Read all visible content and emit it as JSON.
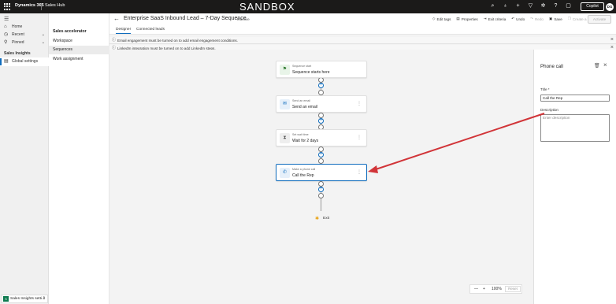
{
  "topbar": {
    "brand": "Dynamics 365",
    "app": "Sales Hub",
    "environment_label": "SANDBOX",
    "copilot": "Copilot",
    "avatar": "DG",
    "icons": [
      "search-icon",
      "lightbulb-icon",
      "plus-icon",
      "filter-icon",
      "settings-icon",
      "help-icon",
      "chat-icon"
    ]
  },
  "left_nav": {
    "home": "Home",
    "recent": "Recent",
    "pinned": "Pinned",
    "section": "Sales Insights",
    "global_settings": "Global settings",
    "area_switcher": "Sales Insights setti...",
    "area_badge": "S"
  },
  "sub_nav": {
    "heading": "Sales accelerator",
    "items": [
      "Workspace",
      "Sequences",
      "Work assignment"
    ]
  },
  "header": {
    "title": "Enterprise SaaS Inbound Lead – 7-Day Sequence",
    "state": "- Inactive",
    "commands": [
      "Edit tags",
      "Properties",
      "Exit criteria",
      "Undo",
      "Redo",
      "Save",
      "Create a copy"
    ],
    "activate": "Activate"
  },
  "tabs": [
    "Designer",
    "Connected leads"
  ],
  "banners": [
    "Email engagement must be turned on to add email engagement conditions.",
    "LinkedIn integration must be turned on to add LinkedIn steps."
  ],
  "steps": [
    {
      "label": "Sequence start",
      "name": "Sequence starts here",
      "icon": "flag-icon",
      "color": "#e8f4e8"
    },
    {
      "label": "Send an email",
      "name": "Send an email",
      "icon": "email-icon",
      "color": "#e6f0fa"
    },
    {
      "label": "Set wait time",
      "name": "Wait for 2 days",
      "icon": "wait-icon",
      "color": "#eeeeee"
    },
    {
      "label": "Make a phone call",
      "name": "Call the Rep",
      "icon": "phone-icon",
      "color": "#e6f0fa"
    }
  ],
  "exit_label": "Exit",
  "zoom": {
    "level": "100%",
    "reset": "Reset"
  },
  "panel": {
    "title": "Phone call",
    "title_label": "Title *",
    "title_value": "Call the Rep",
    "description_label": "Description",
    "description_placeholder": "Enter description"
  },
  "colors": {
    "accent": "#0f6cbd",
    "annotation_arrow": "#d13438",
    "topbar": "#1b1a19"
  }
}
